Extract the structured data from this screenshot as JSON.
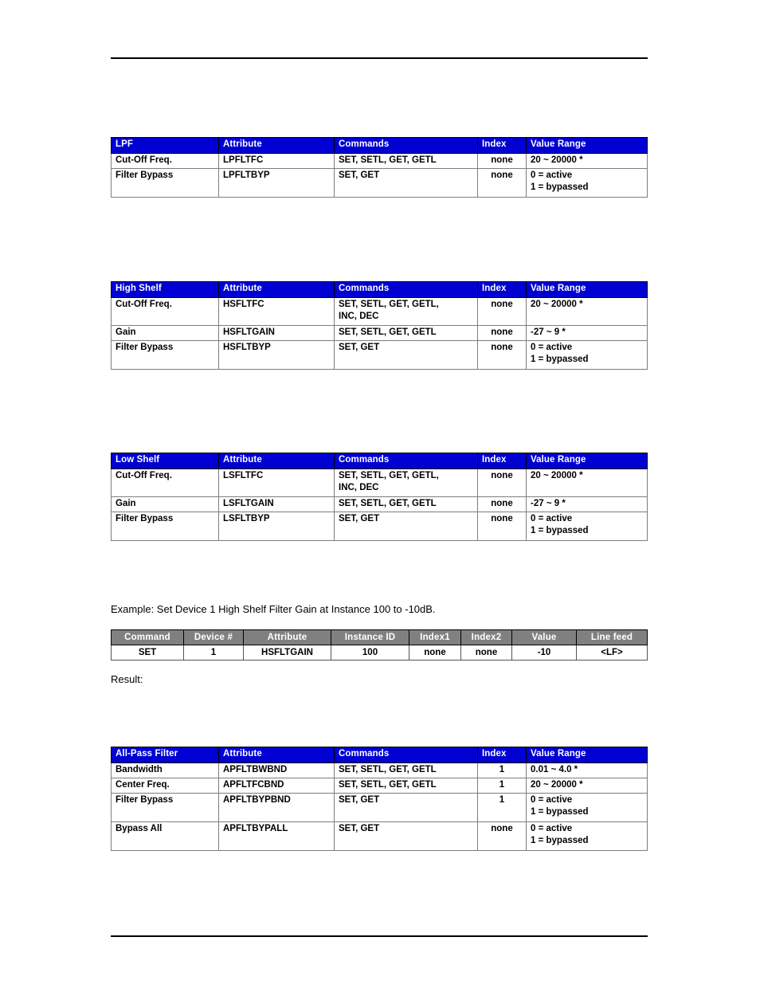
{
  "document": {
    "header_rule": true,
    "footer_rule": true,
    "example_text": "Example: Set Device 1 High Shelf Filter Gain at Instance 100 to -10dB.",
    "result_text": "Result:",
    "colors": {
      "header_blue": "#0000D2",
      "header_grey": "#808080",
      "header_text": "#FFFFFF",
      "grid_line": "#7D7D7D",
      "body_text": "#000000",
      "page_background": "#FFFFFF"
    }
  },
  "tables": {
    "lpf": {
      "columns": [
        "LPF",
        "Attribute",
        "Commands",
        "Index",
        "Value Range"
      ],
      "rows": [
        {
          "name": "Cut-Off Freq.",
          "attribute": "LPFLTFC",
          "commands": [
            "SET, SETL, GET, GETL"
          ],
          "index": "none",
          "value_range": [
            "20 ~ 20000 *"
          ]
        },
        {
          "name": "Filter Bypass",
          "attribute": "LPFLTBYP",
          "commands": [
            "SET, GET"
          ],
          "index": "none",
          "value_range": [
            "0 = active",
            "1 = bypassed"
          ]
        }
      ]
    },
    "high_shelf": {
      "columns": [
        "High Shelf",
        "Attribute",
        "Commands",
        "Index",
        "Value Range"
      ],
      "rows": [
        {
          "name": "Cut-Off Freq.",
          "attribute": "HSFLTFC",
          "commands": [
            "SET, SETL, GET, GETL,",
            "INC, DEC"
          ],
          "index": "none",
          "value_range": [
            "20 ~ 20000 *"
          ]
        },
        {
          "name": "Gain",
          "attribute": "HSFLTGAIN",
          "commands": [
            "SET, SETL, GET, GETL"
          ],
          "index": "none",
          "value_range": [
            "-27 ~ 9 *"
          ]
        },
        {
          "name": "Filter Bypass",
          "attribute": "HSFLTBYP",
          "commands": [
            "SET, GET"
          ],
          "index": "none",
          "value_range": [
            "0 = active",
            "1 = bypassed"
          ]
        }
      ]
    },
    "low_shelf": {
      "columns": [
        "Low Shelf",
        "Attribute",
        "Commands",
        "Index",
        "Value Range"
      ],
      "rows": [
        {
          "name": "Cut-Off Freq.",
          "attribute": "LSFLTFC",
          "commands": [
            "SET, SETL, GET, GETL,",
            "INC, DEC"
          ],
          "index": "none",
          "value_range": [
            "20 ~ 20000 *"
          ]
        },
        {
          "name": "Gain",
          "attribute": "LSFLTGAIN",
          "commands": [
            "SET, SETL, GET, GETL"
          ],
          "index": "none",
          "value_range": [
            "-27 ~ 9 *"
          ]
        },
        {
          "name": "Filter Bypass",
          "attribute": "LSFLTBYP",
          "commands": [
            "SET, GET"
          ],
          "index": "none",
          "value_range": [
            "0 = active",
            "1 = bypassed"
          ]
        }
      ]
    },
    "all_pass": {
      "columns": [
        "All-Pass Filter",
        "Attribute",
        "Commands",
        "Index",
        "Value Range"
      ],
      "rows": [
        {
          "name": "Bandwidth",
          "attribute": "APFLTBWBND",
          "commands": [
            "SET, SETL, GET, GETL"
          ],
          "index": "1",
          "value_range": [
            "0.01 ~ 4.0 *"
          ]
        },
        {
          "name": "Center Freq.",
          "attribute": "APFLTFCBND",
          "commands": [
            "SET, SETL, GET, GETL"
          ],
          "index": "1",
          "value_range": [
            "20 ~ 20000 *"
          ]
        },
        {
          "name": "Filter Bypass",
          "attribute": "APFLTBYPBND",
          "commands": [
            "SET, GET"
          ],
          "index": "1",
          "value_range": [
            "0 = active",
            "1 = bypassed"
          ]
        },
        {
          "name": "Bypass All",
          "attribute": "APFLTBYPALL",
          "commands": [
            "SET, GET"
          ],
          "index": "none",
          "value_range": [
            "0 = active",
            "1 = bypassed"
          ]
        }
      ]
    },
    "command_example": {
      "columns": [
        "Command",
        "Device #",
        "Attribute",
        "Instance ID",
        "Index1",
        "Index2",
        "Value",
        "Line feed"
      ],
      "row": [
        "SET",
        "1",
        "HSFLTGAIN",
        "100",
        "none",
        "none",
        "-10",
        "<LF>"
      ]
    }
  }
}
